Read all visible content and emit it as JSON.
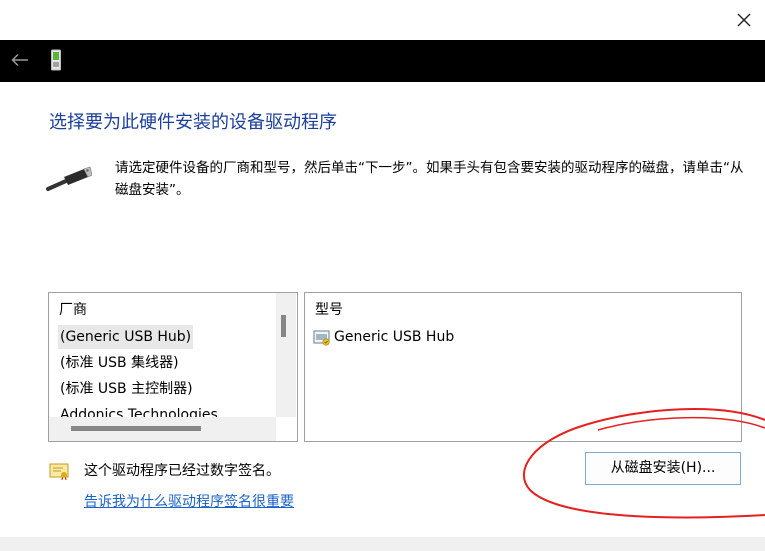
{
  "title": "选择要为此硬件安装的设备驱动程序",
  "instruction": "请选定硬件设备的厂商和型号，然后单击“下一步”。如果手头有包含要安装的驱动程序的磁盘，请单击“从磁盘安装”。",
  "manufacturer_list": {
    "header": "厂商",
    "items": [
      {
        "label": "(Generic USB Hub)",
        "selected": true
      },
      {
        "label": "(标准 USB 集线器)",
        "selected": false
      },
      {
        "label": "(标准 USB 主控制器)",
        "selected": false
      },
      {
        "label": "Addonics Technologies",
        "selected": false
      }
    ]
  },
  "model_list": {
    "header": "型号",
    "items": [
      {
        "label": "Generic USB Hub",
        "icon": "device-driver-icon"
      }
    ]
  },
  "signature": {
    "text": "这个驱动程序已经过数字签名。",
    "link": "告诉我为什么驱动程序签名很重要"
  },
  "buttons": {
    "have_disk": "从磁盘安装(H)..."
  },
  "icons": {
    "close": "close-icon",
    "back": "back-arrow-icon",
    "device": "device-icon",
    "usb": "usb-connector-icon",
    "signature": "certificate-icon"
  },
  "colors": {
    "title": "#1c3f9a",
    "link": "#1b62c9",
    "annotation": "#e5201f",
    "nav_bar": "#000000"
  }
}
